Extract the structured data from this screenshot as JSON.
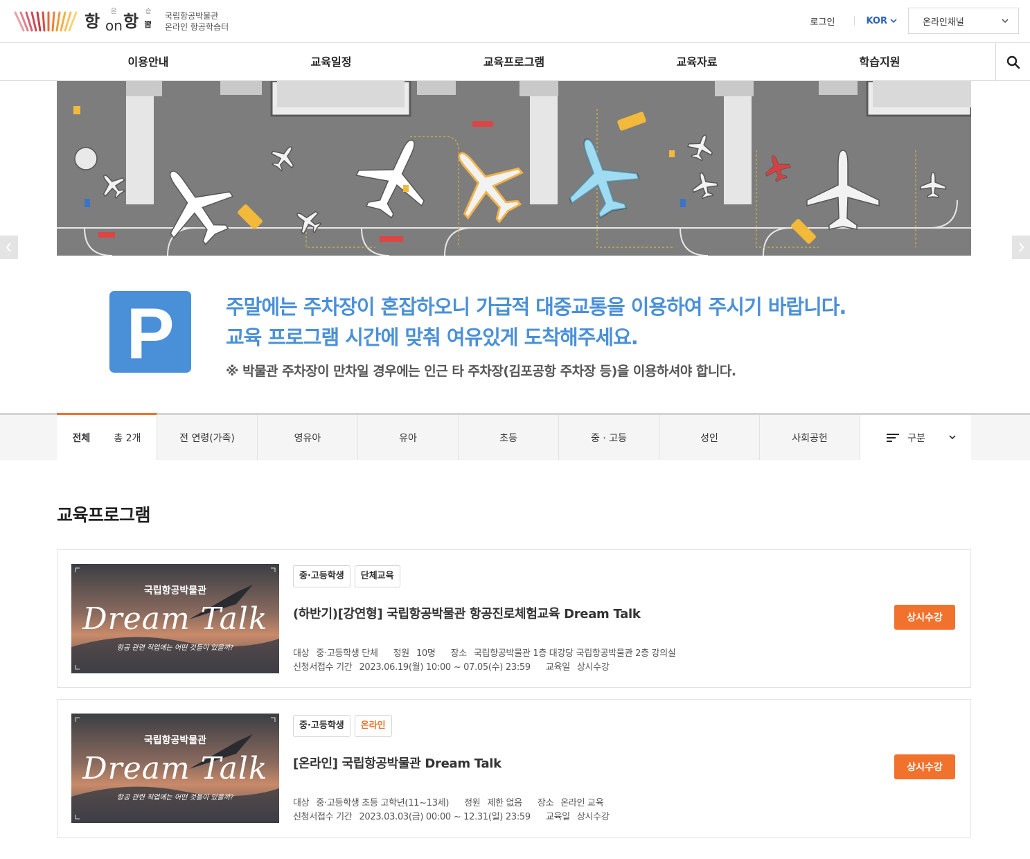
{
  "header": {
    "logo_museum": "국립항공박물관",
    "logo_service": "온라인 항공학습터",
    "logo_word": {
      "big1": "항",
      "small1": "온",
      "on": "on",
      "big2": "항",
      "small2": "습",
      "small3": "習"
    },
    "login": "로그인",
    "lang": "KOR",
    "channel": "온라인채널"
  },
  "nav": {
    "items": [
      {
        "label": "이용안내"
      },
      {
        "label": "교육일정"
      },
      {
        "label": "교육프로그램"
      },
      {
        "label": "교육자료"
      },
      {
        "label": "학습지원"
      }
    ]
  },
  "banner": {
    "parking_letter": "P",
    "line1": "주말에는 주차장이 혼잡하오니 가급적 대중교통을 이용하여 주시기 바랍니다.",
    "line2": "교육 프로그램 시간에 맞춰 여유있게 도착해주세요.",
    "sub": "※ 박물관 주차장이 만차일 경우에는 인근 타 주차장(김포공항 주차장 등)을 이용하셔야 합니다."
  },
  "tabs": {
    "all_label": "전체",
    "all_count": "총 2개",
    "items": [
      {
        "label": "전 연령(가족)"
      },
      {
        "label": "영유아"
      },
      {
        "label": "유아"
      },
      {
        "label": "초등"
      },
      {
        "label": "중 · 고등"
      },
      {
        "label": "성인"
      },
      {
        "label": "사회공헌"
      }
    ],
    "sort_label": "구분"
  },
  "section": {
    "title": "교육프로그램"
  },
  "programs": [
    {
      "thumb_museum": "국립항공박물관",
      "thumb_title": "Dream Talk",
      "thumb_caption": "항공 관련 직업에는 어떤 것들이 있을까?",
      "tags": [
        "중·고등학생",
        "단체교육"
      ],
      "title": "(하반기)[강연형] 국립항공박물관 항공진로체험교육 Dream Talk",
      "target_label": "대상",
      "target": "중·고등학생  단체",
      "capacity_label": "정원",
      "capacity": "10명",
      "place_label": "장소",
      "place": "국립항공박물관 1층 대강당  국립항공박물관 2층 강의실",
      "period_label": "신청서접수 기간",
      "period": "2023.06.19(월) 10:00 ~ 07.05(수) 23:59",
      "date_label": "교육일",
      "date": "상시수강",
      "button": "상시수강"
    },
    {
      "thumb_museum": "국립항공박물관",
      "thumb_title": "Dream Talk",
      "thumb_caption": "항공 관련 직업에는 어떤 것들이 있을까?",
      "tags": [
        "중·고등학생",
        "온라인"
      ],
      "title": "[온라인] 국립항공박물관 Dream Talk",
      "target_label": "대상",
      "target": "중·고등학생  초등 고학년(11~13세)",
      "capacity_label": "정원",
      "capacity": "제한 없음",
      "place_label": "장소",
      "place": "온라인 교육",
      "period_label": "신청서접수 기간",
      "period": "2023.03.03(금) 00:00 ~ 12.31(일) 23:59",
      "date_label": "교육일",
      "date": "상시수강",
      "button": "상시수강"
    }
  ],
  "colors": {
    "accent": "#f0722d",
    "parking_blue": "#4a90d9",
    "lang_blue": "#2b63b6"
  }
}
